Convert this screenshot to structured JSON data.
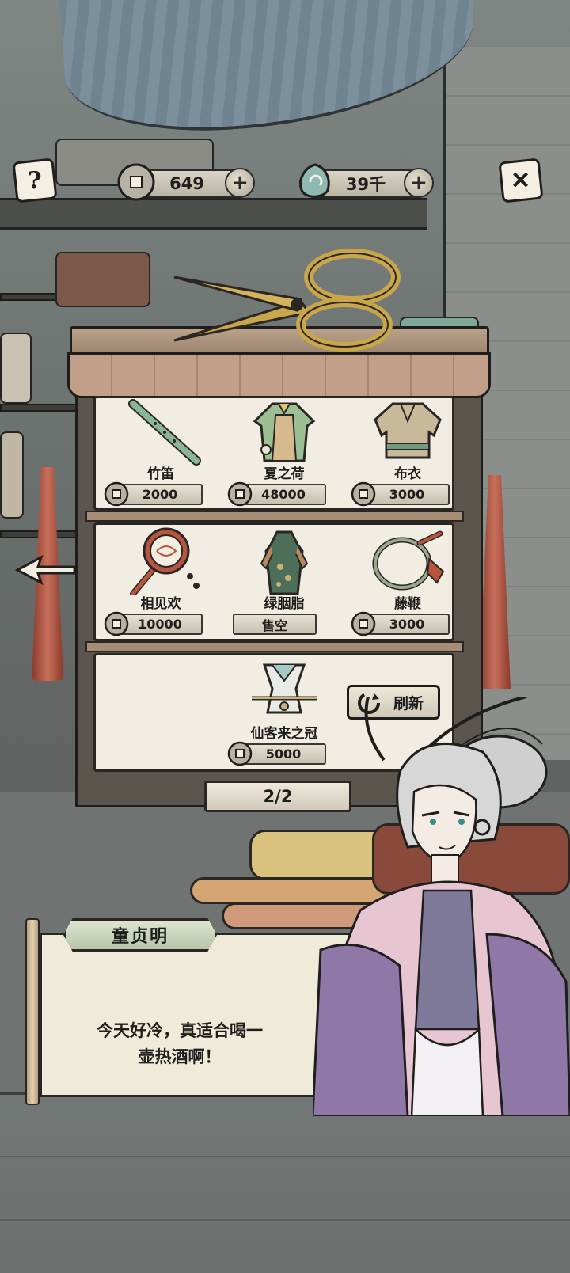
{
  "hud": {
    "help_icon": "question-icon",
    "close_icon": "close-icon",
    "coins": "649",
    "jade": "39千"
  },
  "shop": {
    "rows": [
      [
        {
          "name": "竹笛",
          "price": "2000",
          "icon": "bamboo-flute-icon"
        },
        {
          "name": "夏之荷",
          "price": "48000",
          "icon": "green-robe-icon"
        },
        {
          "name": "布衣",
          "price": "3000",
          "icon": "cloth-shirt-icon"
        }
      ],
      [
        {
          "name": "相见欢",
          "price": "10000",
          "icon": "rattle-drum-icon"
        },
        {
          "name": "绿胭脂",
          "price": "售空",
          "icon": "green-dress-icon"
        },
        {
          "name": "藤鞭",
          "price": "3000",
          "icon": "rattan-whip-icon"
        }
      ],
      [
        {
          "name": "仙客来之冠",
          "price": "5000",
          "icon": "hair-crown-icon"
        }
      ]
    ],
    "refresh_label": "刷新",
    "page": "2/2"
  },
  "dialog": {
    "speaker": "童贞明",
    "text_line1": "今天好冷，真适合喝一",
    "text_line2": "壶热酒啊！"
  },
  "colors": {
    "paper": "#f1ede2",
    "ink": "#1d1d1b",
    "wood": "#a88d76",
    "tassel": "#c8705b",
    "nameplate": "#cbd4bb"
  }
}
